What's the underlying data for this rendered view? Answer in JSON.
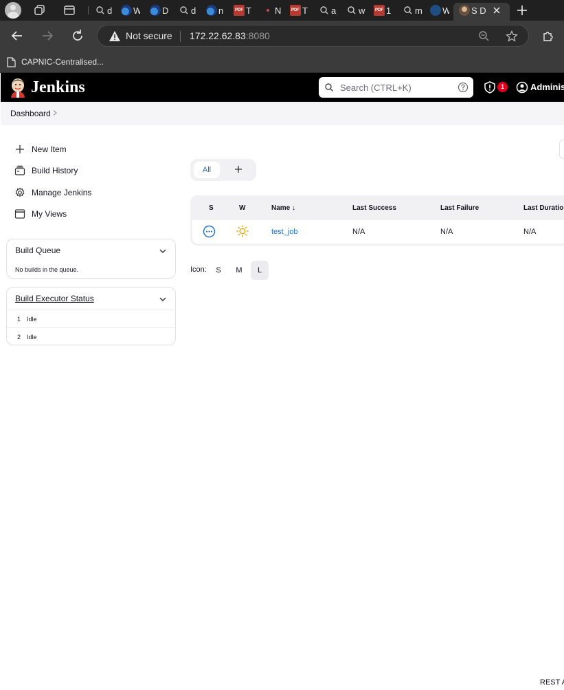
{
  "browser": {
    "tabs": [
      {
        "icon": "search-icon",
        "title": "d"
      },
      {
        "icon": "edge-icon",
        "title": "W"
      },
      {
        "icon": "edge-icon",
        "title": "D"
      },
      {
        "icon": "search-icon",
        "title": "d"
      },
      {
        "icon": "edge-icon",
        "title": "n"
      },
      {
        "icon": "pdf-icon",
        "title": "T"
      },
      {
        "icon": "dot-icon",
        "title": "N"
      },
      {
        "icon": "pdf-icon",
        "title": "T"
      },
      {
        "icon": "search-icon",
        "title": "a"
      },
      {
        "icon": "search-icon",
        "title": "w"
      },
      {
        "icon": "pdf-icon",
        "title": "1"
      },
      {
        "icon": "search-icon",
        "title": "m"
      },
      {
        "icon": "globe-icon",
        "title": "W"
      },
      {
        "icon": "avatar-icon",
        "title": "S D",
        "active": true
      }
    ],
    "pdf_label": "PDF",
    "security_label": "Not secure",
    "url_host": "172.22.62.83",
    "url_port": ":8080",
    "bookmark": "CAPNIC-Centralised..."
  },
  "jenkins": {
    "title": "Jenkins",
    "search_placeholder": "Search (CTRL+K)",
    "alert_count": "1",
    "user": "Administ",
    "breadcrumb": "Dashboard",
    "tasks": [
      {
        "icon": "plus-icon",
        "label": "New Item"
      },
      {
        "icon": "build-history-icon",
        "label": "Build History"
      },
      {
        "icon": "gear-icon",
        "label": "Manage Jenkins"
      },
      {
        "icon": "window-icon",
        "label": "My Views"
      }
    ],
    "build_queue": {
      "title": "Build Queue",
      "empty_text": "No builds in the queue."
    },
    "executors": {
      "title": "Build Executor Status",
      "rows": [
        {
          "num": "1",
          "status": "Idle"
        },
        {
          "num": "2",
          "status": "Idle"
        }
      ]
    },
    "views": {
      "active": "All"
    },
    "table": {
      "headers": {
        "s": "S",
        "w": "W",
        "name": "Name",
        "name_sort": "↓",
        "last_success": "Last Success",
        "last_failure": "Last Failure",
        "last_duration": "Last Duration"
      },
      "rows": [
        {
          "status_icon": "not-built-icon",
          "weather_icon": "sunny-icon",
          "name": "test_job",
          "last_success": "N/A",
          "last_failure": "N/A",
          "last_duration": "N/A"
        }
      ]
    },
    "icon_legend": {
      "label": "Icon:",
      "sizes": [
        "S",
        "M",
        "L"
      ],
      "selected": "L"
    },
    "footer_link": "REST API",
    "colors": {
      "header_bg": "#000000",
      "link": "#1f6fd0",
      "badge": "#e6001f",
      "weather": "#f2a600"
    }
  }
}
